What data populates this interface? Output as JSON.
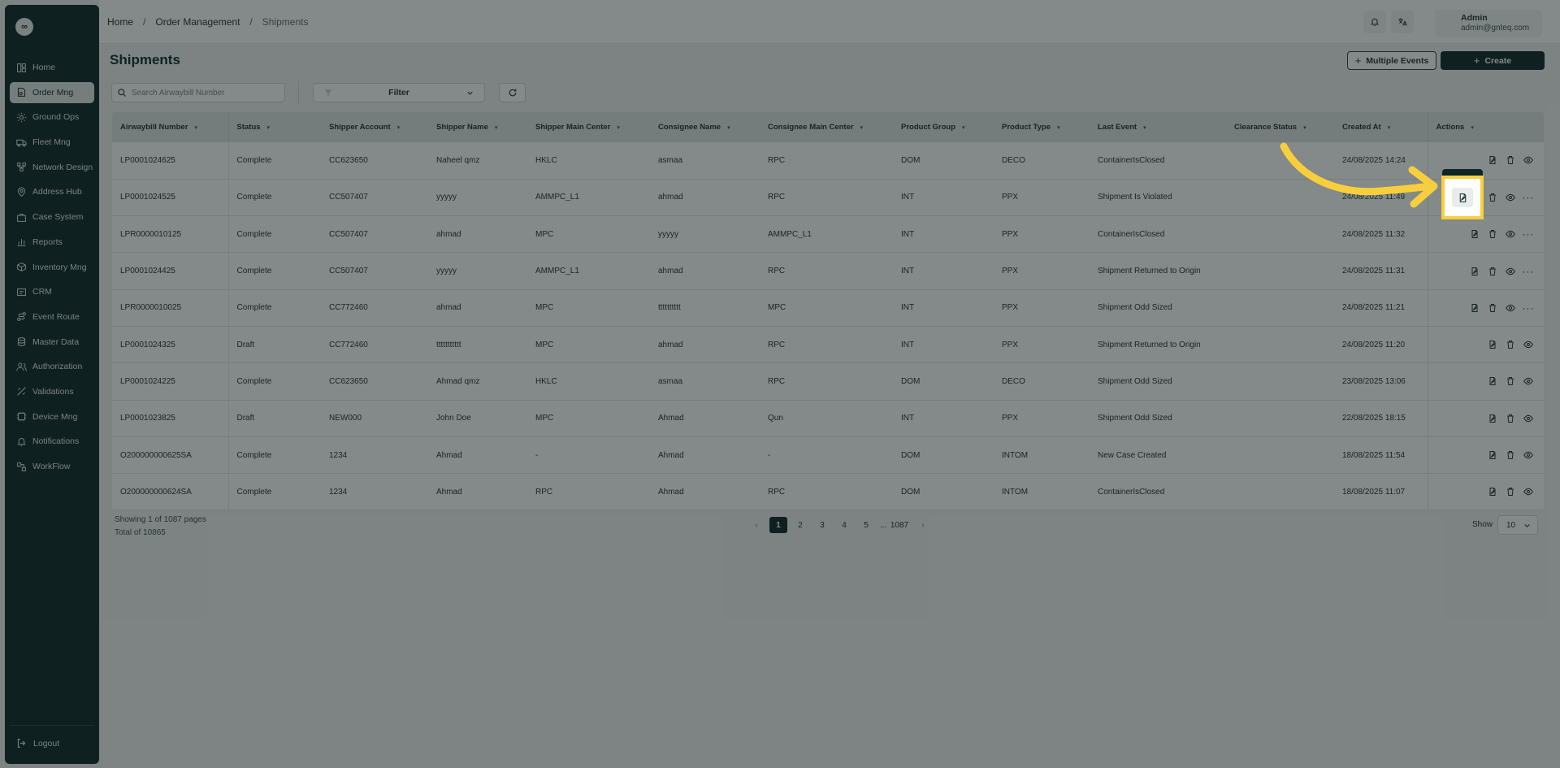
{
  "sidebar": {
    "logo": "∞",
    "items": [
      {
        "label": "Home",
        "icon": "layout-grid-icon"
      },
      {
        "label": "Order Mng",
        "icon": "order-icon",
        "active": true
      },
      {
        "label": "Ground Ops",
        "icon": "settings-icon"
      },
      {
        "label": "Fleet Mng",
        "icon": "truck-icon"
      },
      {
        "label": "Network Design",
        "icon": "network-icon"
      },
      {
        "label": "Address Hub",
        "icon": "map-pin-icon"
      },
      {
        "label": "Case System",
        "icon": "briefcase-icon"
      },
      {
        "label": "Reports",
        "icon": "chart-icon"
      },
      {
        "label": "Inventory Mng",
        "icon": "box-icon"
      },
      {
        "label": "CRM",
        "icon": "crm-icon"
      },
      {
        "label": "Event Route",
        "icon": "route-icon"
      },
      {
        "label": "Master Data",
        "icon": "database-icon"
      },
      {
        "label": "Authorization",
        "icon": "users-icon"
      },
      {
        "label": "Validations",
        "icon": "check-icon"
      },
      {
        "label": "Device Mng",
        "icon": "device-icon"
      },
      {
        "label": "Notifications",
        "icon": "bell-icon"
      },
      {
        "label": "WorkFlow",
        "icon": "workflow-icon"
      }
    ],
    "logout": "Logout"
  },
  "breadcrumb": {
    "home": "Home",
    "section": "Order Management",
    "current": "Shipments",
    "separator": "/"
  },
  "user": {
    "name": "Admin",
    "email": "admin@gnteq.com"
  },
  "page": {
    "title": "Shipments",
    "multiple_events": "Multiple Events",
    "create": "Create",
    "search_placeholder": "Search Airwaybill Number",
    "filter_label": "Filter"
  },
  "table": {
    "columns": [
      "Airwaybill Number",
      "Status",
      "Shipper Account",
      "Shipper Name",
      "Shipper Main Center",
      "Consignee Name",
      "Consignee Main Center",
      "Product Group",
      "Product Type",
      "Last Event",
      "Clearance Status",
      "Created At",
      "Actions"
    ],
    "rows": [
      [
        "LP0001024625",
        "Complete",
        "CC623650",
        "Naheel qmz",
        "HKLC",
        "asmaa",
        "RPC",
        "DOM",
        "DECO",
        "ContainerIsClosed",
        "",
        "24/08/2025 14:24"
      ],
      [
        "LP0001024525",
        "Complete",
        "CC507407",
        "yyyyy",
        "AMMPC_L1",
        "ahmad",
        "RPC",
        "INT",
        "PPX",
        "Shipment Is Violated",
        "",
        "24/08/2025 11:49"
      ],
      [
        "LPR0000010125",
        "Complete",
        "CC507407",
        "ahmad",
        "MPC",
        "yyyyy",
        "AMMPC_L1",
        "INT",
        "PPX",
        "ContainerIsClosed",
        "",
        "24/08/2025 11:32"
      ],
      [
        "LP0001024425",
        "Complete",
        "CC507407",
        "yyyyy",
        "AMMPC_L1",
        "ahmad",
        "RPC",
        "INT",
        "PPX",
        "Shipment Returned to Origin",
        "",
        "24/08/2025 11:31"
      ],
      [
        "LPR0000010025",
        "Complete",
        "CC772460",
        "ahmad",
        "MPC",
        "tttttttttt",
        "MPC",
        "INT",
        "PPX",
        "Shipment Odd Sized",
        "",
        "24/08/2025 11:21"
      ],
      [
        "LP0001024325",
        "Draft",
        "CC772460",
        "ttttttttttt",
        "MPC",
        "ahmad",
        "RPC",
        "INT",
        "PPX",
        "Shipment Returned to Origin",
        "",
        "24/08/2025 11:20"
      ],
      [
        "LP0001024225",
        "Complete",
        "CC623650",
        "Ahmad qmz",
        "HKLC",
        "asmaa",
        "RPC",
        "DOM",
        "DECO",
        "Shipment Odd Sized",
        "",
        "23/08/2025 13:06"
      ],
      [
        "LP0001023825",
        "Draft",
        "NEW000",
        "John Doe",
        "MPC",
        "Ahmad",
        "Qun",
        "INT",
        "PPX",
        "Shipment Odd Sized",
        "",
        "22/08/2025 18:15"
      ],
      [
        "O200000000625SA",
        "Complete",
        "1234",
        "Ahmad",
        "-",
        "Ahmad",
        "-",
        "DOM",
        "INTOM",
        "New Case Created",
        "",
        "18/08/2025 11:54"
      ],
      [
        "O200000000624SA",
        "Complete",
        "1234",
        "Ahmad",
        "RPC",
        "Ahmad",
        "RPC",
        "DOM",
        "INTOM",
        "ContainerIsClosed",
        "",
        "18/08/2025 11:07"
      ]
    ]
  },
  "footer": {
    "showing": "Showing 1 of 1087 pages",
    "total": "Total of 10865",
    "pages": [
      "1",
      "2",
      "3",
      "4",
      "5",
      "...",
      "1087"
    ],
    "prev": "‹",
    "next": "›",
    "show_label": "Show",
    "page_size": "10"
  },
  "colors": {
    "sidebar": "#0c2526",
    "highlight": "#f7cf3d",
    "arrow": "#f7cf3d"
  }
}
